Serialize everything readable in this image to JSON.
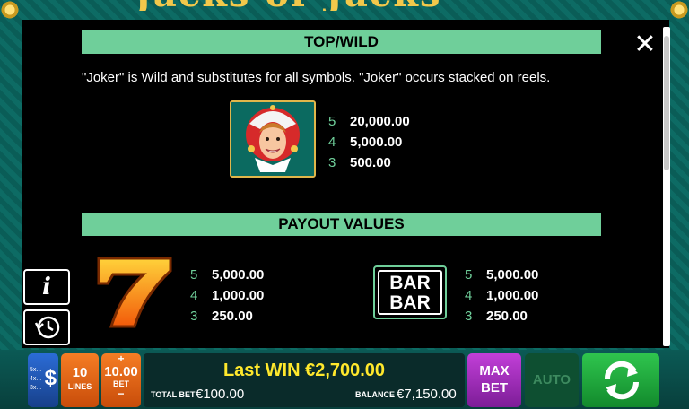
{
  "game_title_partial": "Jacks or Jacks",
  "sections": {
    "top_wild_title": "TOP/WILD",
    "top_wild_desc": "\"Joker\" is Wild and substitutes for all symbols. \"Joker\" occurs stacked on reels.",
    "payout_title": "PAYOUT VALUES"
  },
  "joker_pays": [
    {
      "count": "5",
      "value": "20,000.00"
    },
    {
      "count": "4",
      "value": "5,000.00"
    },
    {
      "count": "3",
      "value": "500.00"
    }
  ],
  "seven_pays": [
    {
      "count": "5",
      "value": "5,000.00"
    },
    {
      "count": "4",
      "value": "1,000.00"
    },
    {
      "count": "3",
      "value": "250.00"
    }
  ],
  "bar_pays": [
    {
      "count": "5",
      "value": "5,000.00"
    },
    {
      "count": "4",
      "value": "1,000.00"
    },
    {
      "count": "3",
      "value": "250.00"
    }
  ],
  "symbols": {
    "seven": "7",
    "bar_top": "BAR",
    "bar_bottom": "BAR"
  },
  "controls": {
    "close_icon": "close-icon",
    "info_label": "i",
    "credit_rows": [
      "5x...",
      "4x...",
      "3x..."
    ],
    "credit_symbol": "$",
    "lines_value": "10",
    "lines_label": "LINES",
    "bet_plus": "+",
    "bet_value": "10.00",
    "bet_label": "BET",
    "bet_minus": "−",
    "last_win": "Last WIN €2,700.00",
    "total_bet_label": "TOTAL BET",
    "total_bet_value": "€100.00",
    "balance_label": "BALANCE",
    "balance_value": "€7,150.00",
    "max_bet_1": "MAX",
    "max_bet_2": "BET",
    "auto": "AUTO"
  },
  "colors": {
    "accent": "#6fcf9a",
    "win": "#ffe82c",
    "lines_btn": "#f57d24",
    "maxbet_btn": "#c23fd8",
    "spin_btn": "#2fc54e"
  }
}
